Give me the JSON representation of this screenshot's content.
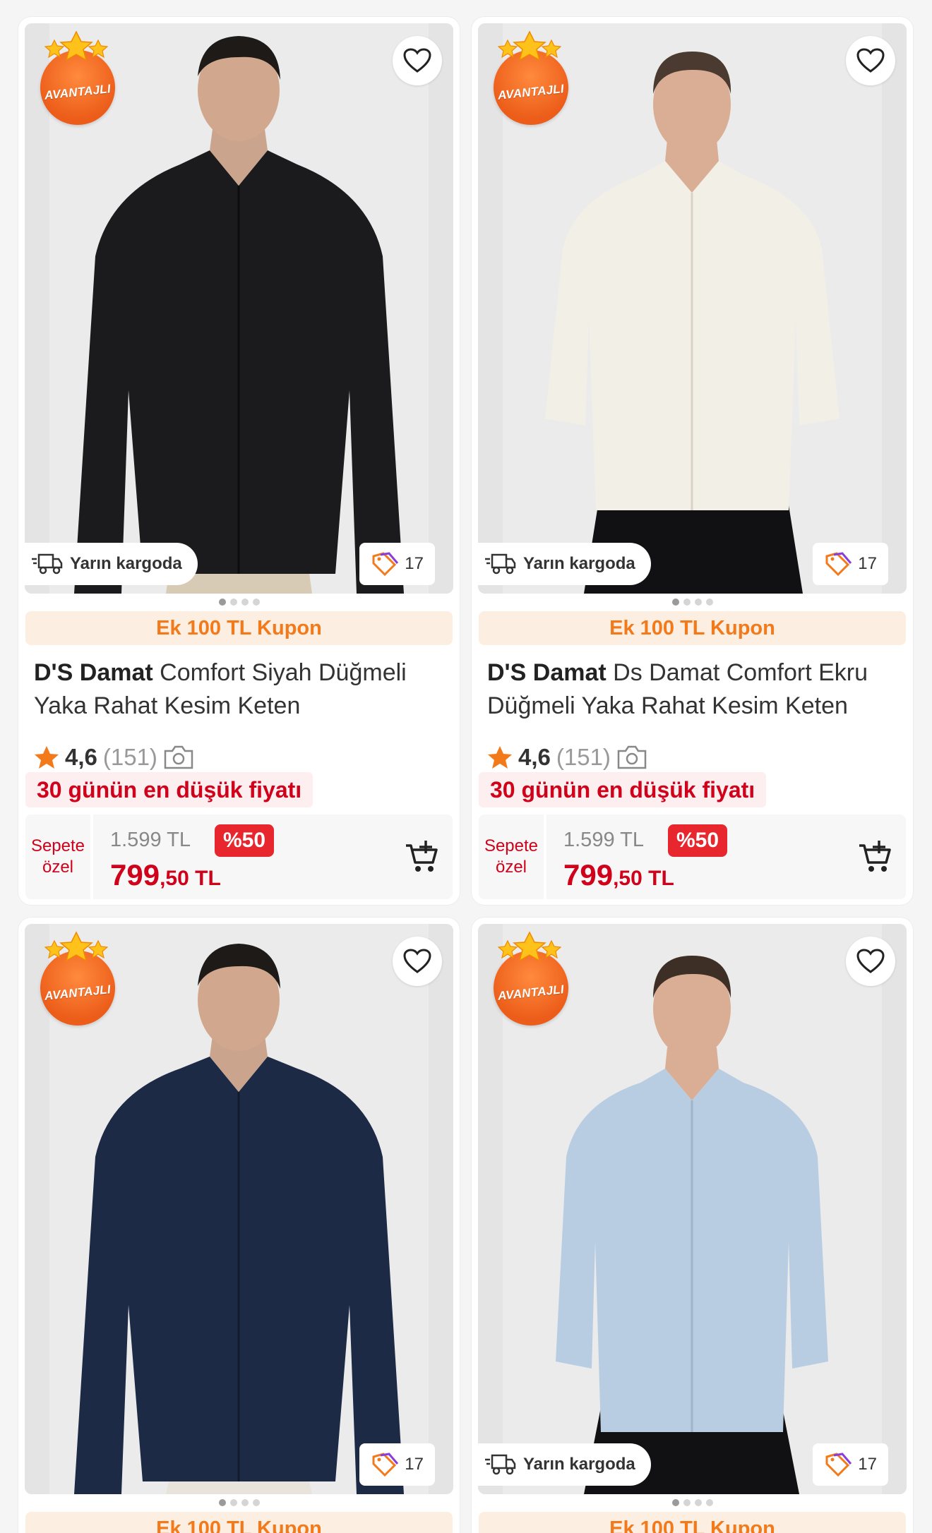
{
  "colors": {
    "accent": "#f27a1a",
    "price_red": "#d0021b",
    "discount_bg": "#e8262d",
    "coupon_bg": "#fdeee2"
  },
  "products": [
    {
      "badge": "AVANTAJLI",
      "shirt_color": "#1b1b1d",
      "cargo": "Yarın kargoda",
      "tag_count": "17",
      "coupon": "Ek 100 TL Kupon",
      "brand": "D'S Damat",
      "name": "Comfort Siyah Düğmeli Yaka Rahat Kesim Keten",
      "rating": "4,6",
      "rating_count": "(151)",
      "lowest_price": "30 günün en düşük fiyatı",
      "special": [
        "Sepete",
        "özel"
      ],
      "old_price": "1.599 TL",
      "discount": "%50",
      "price_main": "799",
      "price_cents": ",50 TL"
    },
    {
      "badge": "AVANTAJLI",
      "shirt_color": "#f2efe6",
      "cargo": "Yarın kargoda",
      "tag_count": "17",
      "coupon": "Ek 100 TL Kupon",
      "brand": "D'S Damat",
      "name": "Ds Damat Comfort Ekru Düğmeli Yaka Rahat Kesim Keten",
      "rating": "4,6",
      "rating_count": "(151)",
      "lowest_price": "30 günün en düşük fiyatı",
      "special": [
        "Sepete",
        "özel"
      ],
      "old_price": "1.599 TL",
      "discount": "%50",
      "price_main": "799",
      "price_cents": ",50 TL"
    },
    {
      "badge": "AVANTAJLI",
      "shirt_color": "#1d2a46",
      "tag_count": "17",
      "coupon": "Ek 100 TL Kupon"
    },
    {
      "badge": "AVANTAJLI",
      "shirt_color": "#b9cde2",
      "cargo": "Yarın kargoda",
      "tag_count": "17",
      "coupon": "Ek 100 TL Kupon"
    }
  ]
}
